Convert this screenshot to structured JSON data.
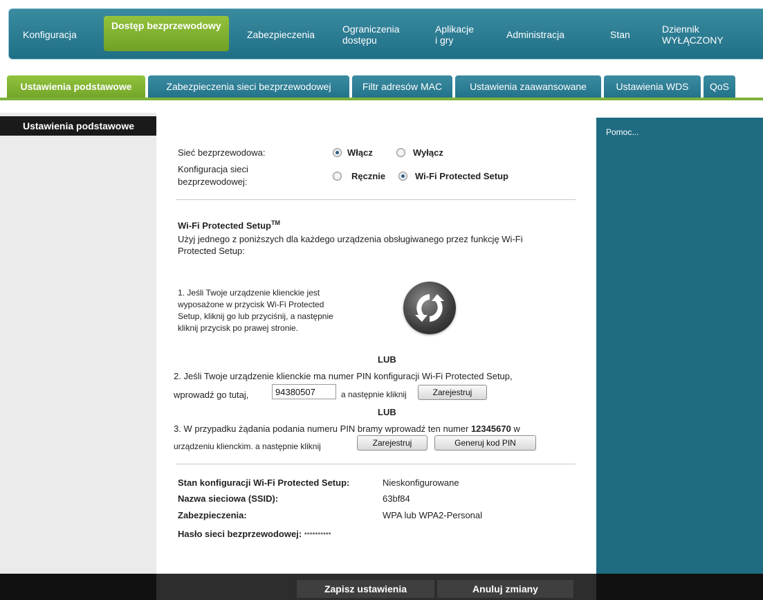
{
  "top_nav": {
    "items": [
      {
        "label": "Konfiguracja"
      },
      {
        "label_line1": "Dostęp",
        "label_line2": "bezprzewodowy"
      },
      {
        "label": "Zabezpieczenia"
      },
      {
        "label_line1": "Ograniczenia",
        "label_line2": "dostępu"
      },
      {
        "label_line1": "Aplikacje",
        "label_line2": "i gry"
      },
      {
        "label": "Administracja"
      },
      {
        "label": "Stan"
      },
      {
        "label_line1": "Dziennik",
        "label_line2": "WYŁĄCZONY"
      }
    ]
  },
  "sub_tabs": [
    {
      "label": "Ustawienia podstawowe"
    },
    {
      "label": "Zabezpieczenia sieci bezprzewodowej"
    },
    {
      "label": "Filtr adresów MAC"
    },
    {
      "label": "Ustawienia zaawansowane"
    },
    {
      "label": "Ustawienia WDS"
    },
    {
      "label": "QoS"
    }
  ],
  "sidebar": {
    "title": "Ustawienia podstawowe"
  },
  "help": {
    "label": "Pomoc..."
  },
  "form": {
    "wireless_network": {
      "label": "Sieć bezprzewodowa:",
      "opt_on": "Włącz",
      "opt_off": "Wyłącz",
      "selected": "on"
    },
    "wireless_config": {
      "label_line1": "Konfiguracja sieci",
      "label_line2": "bezprzewodowej:",
      "opt_manual": "Ręcznie",
      "opt_wps": "Wi-Fi Protected Setup",
      "selected": "wps"
    }
  },
  "wps": {
    "heading": "Wi-Fi Protected Setup",
    "heading_sup": "TM",
    "intro_line1": "Użyj jednego z poniższych dla każdego urządzenia obsługiwanego przez funkcję Wi-Fi",
    "intro_line2": "Protected Setup:",
    "step1_lines": [
      "1. Jeśli Twoje urządzenie klienckie jest",
      "wyposażone w przycisk Wi-Fi Protected",
      "Setup, kliknij go lub przyciśnij, a następnie",
      "kliknij przycisk po prawej stronie."
    ],
    "or_label": "LUB",
    "step2_line1": "2. Jeśli Twoje urządzenie klienckie ma numer PIN konfiguracji Wi-Fi Protected Setup,",
    "step2_pre": "wprowadź go tutaj,",
    "step2_pin_value": "94380507",
    "step2_post": "a następnie kliknij",
    "register_label": "Zarejestruj",
    "step3_line1_pre": "3. W przypadku żądania podania numeru PIN bramy wprowadź ten numer ",
    "step3_pin": "12345670",
    "step3_line1_post": " w",
    "step3_line2": "urządzeniu klienckim. a następnie kliknij",
    "generate_label": "Generuj kod PIN"
  },
  "status": {
    "config_state_label": "Stan konfiguracji Wi-Fi Protected Setup:",
    "config_state_value": "Nieskonfigurowane",
    "ssid_label": "Nazwa sieciowa (SSID):",
    "ssid_value": "63bf84",
    "security_label": "Zabezpieczenia:",
    "security_value": "WPA lub WPA2-Personal",
    "password_label": "Hasło sieci bezprzewodowej:",
    "password_value": "**********"
  },
  "footer": {
    "save_label": "Zapisz ustawienia",
    "cancel_label": "Anuluj zmiany"
  },
  "colors": {
    "accent_green": "#7db23a",
    "nav_blue": "#23738a",
    "help_blue": "#1f6c82"
  }
}
